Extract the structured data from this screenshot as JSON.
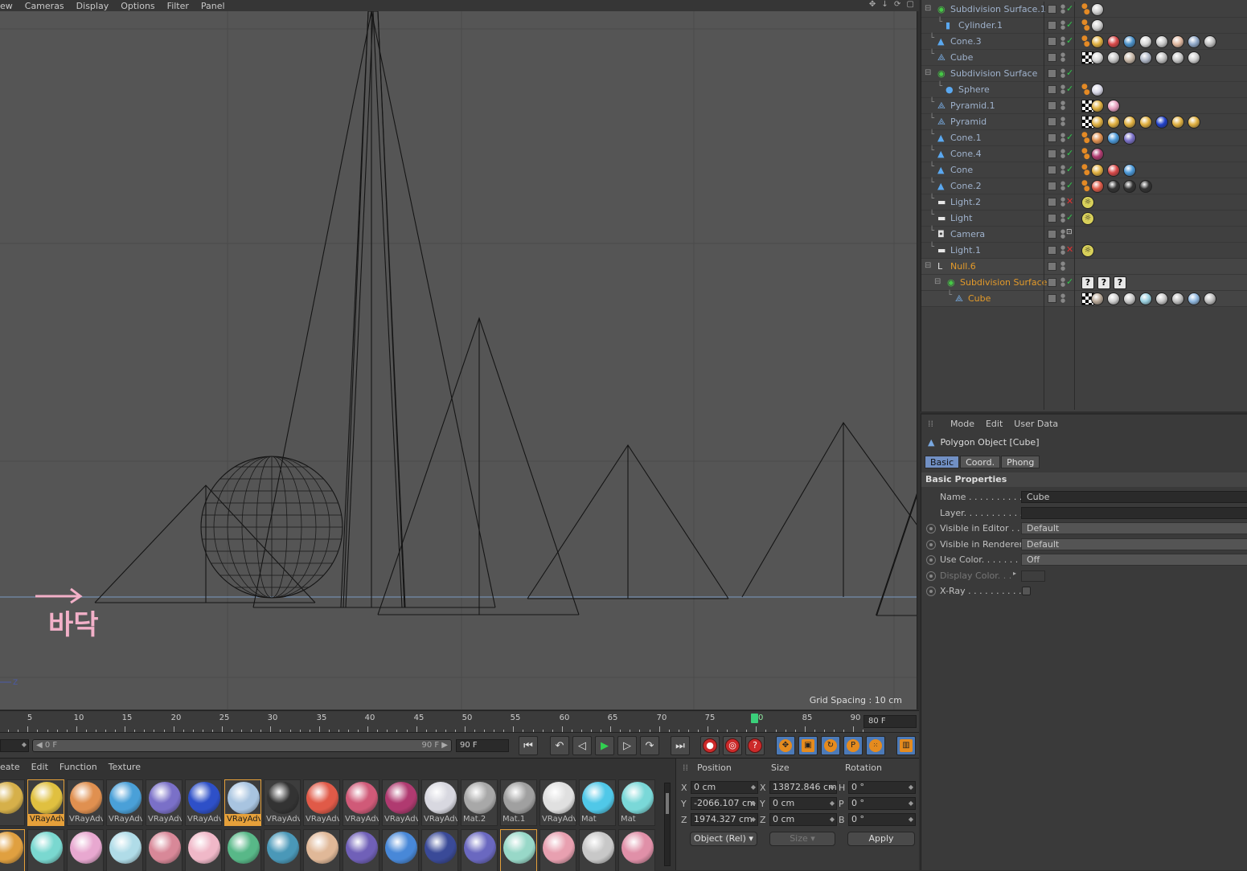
{
  "viewport_menu": {
    "items": [
      "ew",
      "Cameras",
      "Display",
      "Options",
      "Filter",
      "Panel"
    ],
    "icons": "✥ ↓ ⟳ ▢"
  },
  "viewport": {
    "grid_spacing": "Grid Spacing : 10 cm",
    "annotation_text": "바닥",
    "annotation_color": "#f2b0c8",
    "axis_label": "Z"
  },
  "timeline": {
    "labels": [
      "5",
      "10",
      "15",
      "20",
      "25",
      "30",
      "35",
      "40",
      "45",
      "50",
      "55",
      "60",
      "65",
      "70",
      "75",
      "80",
      "85",
      "90"
    ],
    "current_frame": 80,
    "current_frame_field": "80 F"
  },
  "transport": {
    "start_field": "",
    "slider_left": "◀ 0 F",
    "slider_right": "90 F ▶",
    "end_field": "90 F"
  },
  "material_manager": {
    "menu": [
      "eate",
      "Edit",
      "Function",
      "Texture"
    ],
    "row1": [
      {
        "label": "",
        "color": "#d6b04a"
      },
      {
        "label": "VRayAdv",
        "color": "#e0c040",
        "selected": true
      },
      {
        "label": "VRayAdv",
        "color": "#e09050"
      },
      {
        "label": "VRayAdv",
        "color": "#4aa0d8"
      },
      {
        "label": "VRayAdv",
        "color": "#7a70c8"
      },
      {
        "label": "VRayAdv",
        "color": "#2e50c8"
      },
      {
        "label": "VRayAdv",
        "color": "#a8c4e0",
        "selected": true
      },
      {
        "label": "VRayAdv",
        "color": "#333333"
      },
      {
        "label": "VRayAdv",
        "color": "#e05a48"
      },
      {
        "label": "VRayAdv",
        "color": "#d05a78"
      },
      {
        "label": "VRayAdv",
        "color": "#b03a70"
      },
      {
        "label": "VRayAdv",
        "color": "#d8d8e0"
      },
      {
        "label": "Mat.2",
        "color": "#a8a8a8"
      },
      {
        "label": "Mat.1",
        "color": "#a0a0a0"
      },
      {
        "label": "VRayAdv",
        "color": "#e0e0e0"
      },
      {
        "label": "Mat",
        "color": "#50c8e8"
      },
      {
        "label": "Mat",
        "color": "#7ad8d8"
      }
    ],
    "row2": [
      {
        "color": "#e0a040",
        "selected": true
      },
      {
        "color": "#7ad8d0"
      },
      {
        "color": "#e8a8d0"
      },
      {
        "color": "#b0dce8"
      },
      {
        "color": "#d88898"
      },
      {
        "color": "#f0b8c8"
      },
      {
        "color": "#58b888"
      },
      {
        "color": "#4a98b8"
      },
      {
        "color": "#e0b898"
      },
      {
        "color": "#7060b8"
      },
      {
        "color": "#4888d8"
      },
      {
        "color": "#3a4a98"
      },
      {
        "color": "#6a68c0"
      },
      {
        "color": "#98d8c8",
        "selected": true
      },
      {
        "color": "#e8a0b0"
      },
      {
        "color": "#c8c8c8"
      },
      {
        "color": "#e090a8"
      }
    ]
  },
  "coordinates": {
    "headers": {
      "position": "Position",
      "size": "Size",
      "rotation": "Rotation"
    },
    "rows": [
      {
        "axis": "X",
        "pos": "0 cm",
        "saxis": "X",
        "size": "13872.846 cm",
        "raxis": "H",
        "rot": "0 °"
      },
      {
        "axis": "Y",
        "pos": "-2066.107 cm",
        "saxis": "Y",
        "size": "0 cm",
        "raxis": "P",
        "rot": "0 °"
      },
      {
        "axis": "Z",
        "pos": "1974.327 cm",
        "saxis": "Z",
        "size": "0 cm",
        "raxis": "B",
        "rot": "0 °"
      }
    ],
    "mode_dropdown": "Object (Rel)",
    "size_dropdown": "Size",
    "apply": "Apply"
  },
  "object_manager": {
    "objects": [
      {
        "name": "Subdivision Surface.1",
        "icon": "subdiv",
        "check": "ok",
        "tags": [
          "phong:#d0d0d0"
        ]
      },
      {
        "name": "Cylinder.1",
        "icon": "cylinder",
        "check": "ok",
        "tags": [
          "phong",
          "#d0d0d0"
        ]
      },
      {
        "name": "Cone.3",
        "icon": "cone",
        "check": "ok",
        "tags": [
          "phong",
          "#e0b040",
          "#d84848",
          "#4a90c8",
          "#d8d8d8",
          "#c8c8c8",
          "#e0b8a0",
          "#90a8c8",
          "#c0c0c0"
        ]
      },
      {
        "name": "Cube",
        "icon": "poly",
        "check": "",
        "tags": [
          "phong",
          "chk",
          "#d8d8d8",
          "#c8c8c8",
          "#c8b8a8",
          "#b0b8c8",
          "#c0c0c0",
          "#c8c8c8",
          "#d0d0d0"
        ]
      },
      {
        "name": "Subdivision Surface",
        "icon": "subdiv",
        "check": "ok",
        "tags": []
      },
      {
        "name": "Sphere",
        "icon": "sphere",
        "check": "ok",
        "tags": [
          "phong",
          "#d8d8e8"
        ]
      },
      {
        "name": "Pyramid.1",
        "icon": "poly",
        "check": "",
        "tags": [
          "chk",
          "#e0b040",
          "#e8a0c0"
        ]
      },
      {
        "name": "Pyramid",
        "icon": "poly",
        "check": "",
        "tags": [
          "chk",
          "#e0b040",
          "#e0b040",
          "#e0b040",
          "#e0b040",
          "#2040c8",
          "#e0b040",
          "#e0b040"
        ]
      },
      {
        "name": "Cone.1",
        "icon": "cone",
        "check": "ok",
        "tags": [
          "phong",
          "#e09050",
          "#4a98d8",
          "#7a70c8"
        ]
      },
      {
        "name": "Cone.4",
        "icon": "cone",
        "check": "ok",
        "tags": [
          "phong",
          "#b03a70"
        ]
      },
      {
        "name": "Cone",
        "icon": "cone",
        "check": "ok",
        "tags": [
          "phong",
          "#e0b040",
          "#d84848",
          "#4a98d8"
        ]
      },
      {
        "name": "Cone.2",
        "icon": "cone",
        "check": "ok",
        "tags": [
          "phong",
          "#e05a48",
          "#333333",
          "#333333",
          "#333333"
        ]
      },
      {
        "name": "Light.2",
        "icon": "light",
        "check": "x",
        "tags": [
          "light"
        ]
      },
      {
        "name": "Light",
        "icon": "light",
        "check": "ok",
        "tags": [
          "light"
        ]
      },
      {
        "name": "Camera",
        "icon": "camera",
        "check": "cam",
        "tags": []
      },
      {
        "name": "Light.1",
        "icon": "light",
        "check": "x",
        "tags": [
          "light"
        ]
      },
      {
        "name": "Null.6",
        "icon": "null",
        "check": "",
        "tags": []
      },
      {
        "name": "Subdivision Surface",
        "icon": "subdiv",
        "check": "ok",
        "tags": [
          "q",
          "q",
          "q"
        ]
      },
      {
        "name": "Cube",
        "icon": "poly",
        "check": "",
        "tags": [
          "phong",
          "chk",
          "#b8a898",
          "#d0d0d0",
          "#c8c8c8",
          "#9ad0e0",
          "#c8c8c8",
          "#c0c0c0",
          "#90b8e0",
          "#c0c0c0"
        ]
      }
    ]
  },
  "attributes": {
    "menu": [
      "Mode",
      "Edit",
      "User Data"
    ],
    "title": "Polygon Object [Cube]",
    "tabs": [
      "Basic",
      "Coord.",
      "Phong"
    ],
    "section": "Basic Properties",
    "props": [
      {
        "label": "Name . . . . . . . . . . .",
        "value": "Cube",
        "kind": "field"
      },
      {
        "label": "Layer. . . . . . . . . . . .",
        "value": "",
        "kind": "field"
      },
      {
        "label": "Visible in Editor . .",
        "value": "Default",
        "kind": "dropdown"
      },
      {
        "label": "Visible in Renderer",
        "value": "Default",
        "kind": "dropdown"
      },
      {
        "label": "Use Color. . . . . . . .",
        "value": "Off",
        "kind": "dropdown"
      },
      {
        "label": "Display Color. . .",
        "value": "",
        "kind": "color"
      },
      {
        "label": "X-Ray . . . . . . . . . . .",
        "value": "",
        "kind": "check"
      }
    ]
  }
}
